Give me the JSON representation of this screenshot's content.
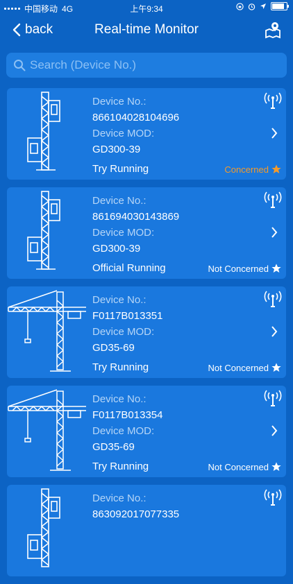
{
  "status_bar": {
    "carrier": "中国移动",
    "network": "4G",
    "time": "上午9:34"
  },
  "navbar": {
    "back_label": "back",
    "title": "Real-time Monitor"
  },
  "search": {
    "placeholder": "Search (Device No.)"
  },
  "labels": {
    "device_no": "Device No.:",
    "device_mod": "Device MOD:"
  },
  "colors": {
    "background": "#0c63c4",
    "card": "#1a78de",
    "concerned": "#f39a2b"
  },
  "devices": [
    {
      "device_no": "866104028104696",
      "model": "GD300-39",
      "run_status": "Try Running",
      "concern": "Concerned",
      "concerned": true,
      "image": "elevator-icon"
    },
    {
      "device_no": "861694030143869",
      "model": "GD300-39",
      "run_status": "Official Running",
      "concern": "Not Concerned",
      "concerned": false,
      "image": "elevator-icon"
    },
    {
      "device_no": "F0117B013351",
      "model": "GD35-69",
      "run_status": "Try Running",
      "concern": "Not Concerned",
      "concerned": false,
      "image": "tower-crane-icon"
    },
    {
      "device_no": "F0117B013354",
      "model": "GD35-69",
      "run_status": "Try Running",
      "concern": "Not Concerned",
      "concerned": false,
      "image": "tower-crane-icon"
    },
    {
      "device_no": "863092017077335",
      "model": "",
      "run_status": "",
      "concern": "",
      "concerned": false,
      "image": "elevator-icon"
    }
  ]
}
